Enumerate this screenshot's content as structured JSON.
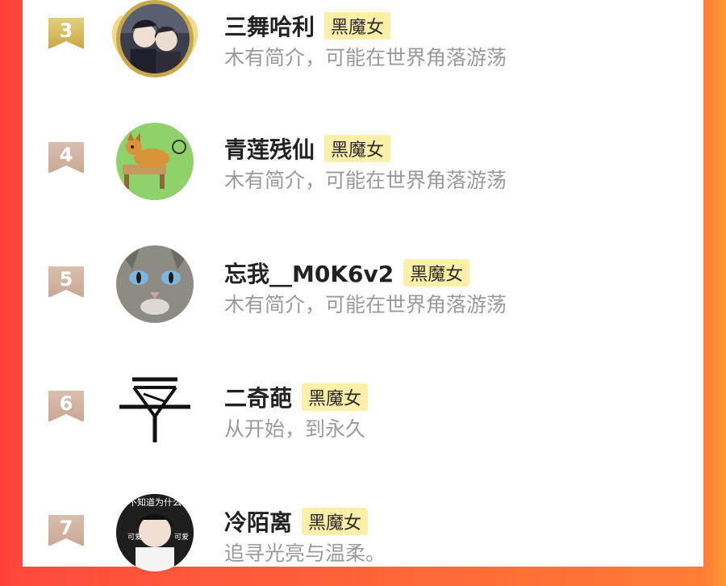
{
  "entries": [
    {
      "rank": "3",
      "name": "三舞哈利",
      "badge": "黑魔女",
      "bio": "木有简介，可能在世界角落游荡",
      "avatar": "anime-couple-avatar",
      "medal": "gold-wings"
    },
    {
      "rank": "4",
      "name": "青莲残仙",
      "badge": "黑魔女",
      "bio": "木有简介，可能在世界角落游荡",
      "avatar": "shiba-dog-avatar"
    },
    {
      "rank": "5",
      "name": "忘我__M0K6v2",
      "badge": "黑魔女",
      "bio": "木有简介，可能在世界角落游荡",
      "avatar": "cat-face-avatar"
    },
    {
      "rank": "6",
      "name": "二奇葩",
      "badge": "黑魔女",
      "bio": "从开始，到永久",
      "avatar": "symbol-logo-avatar"
    },
    {
      "rank": "7",
      "name": "冷陌离",
      "badge": "黑魔女",
      "bio": "追寻光亮与温柔。",
      "avatar": "sticker-boy-avatar"
    }
  ],
  "avatar_texts": {
    "sticker_top": "不知道为什么",
    "sticker_left": "可爱",
    "sticker_right": "可爱"
  },
  "colors": {
    "background_left": "#ff3f3a",
    "background_right": "#ff9a30",
    "badge_bg": "#fcefa9",
    "rank_gold": "#d8bd63",
    "rank_plain": "#d2b6a2",
    "bio_text": "#9a9a9a"
  }
}
